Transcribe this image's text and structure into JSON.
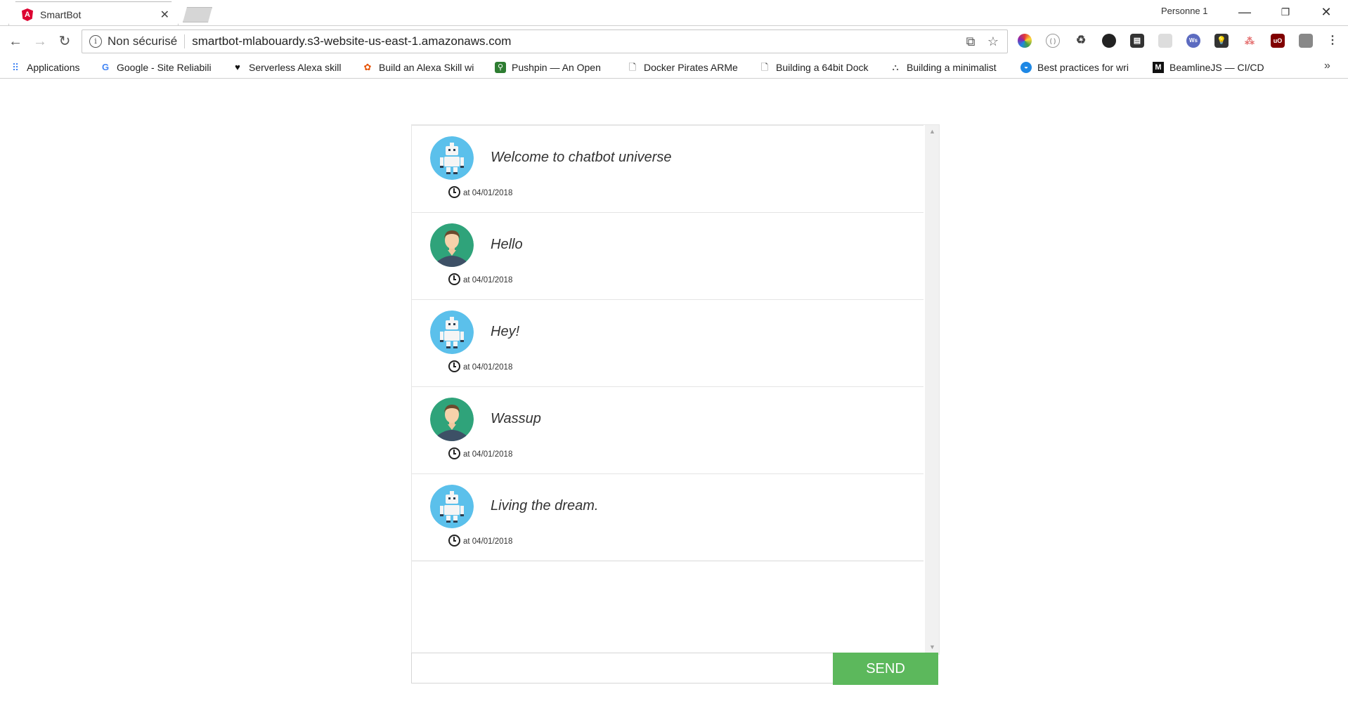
{
  "browser": {
    "tab_title": "SmartBot",
    "profile_name": "Personne 1",
    "security_label": "Non sécurisé",
    "url": "smartbot-mlabouardy.s3-website-us-east-1.amazonaws.com"
  },
  "bookmarks": [
    {
      "label": "Applications",
      "icon": "apps-grid-icon"
    },
    {
      "label": "Google - Site Reliabili",
      "icon": "google-icon"
    },
    {
      "label": "Serverless Alexa skill",
      "icon": "heart-icon"
    },
    {
      "label": "Build an Alexa Skill wi",
      "icon": "bookmark-logo-icon"
    },
    {
      "label": "Pushpin — An Open",
      "icon": "pushpin-icon"
    },
    {
      "label": "Docker Pirates ARMe",
      "icon": "page-icon"
    },
    {
      "label": "Building a 64bit Dock",
      "icon": "page-icon"
    },
    {
      "label": "Building a minimalist",
      "icon": "building-icon"
    },
    {
      "label": "Best practices for wri",
      "icon": "docker-icon"
    },
    {
      "label": "BeamlineJS — CI/CD",
      "icon": "medium-icon"
    }
  ],
  "chat": {
    "messages": [
      {
        "sender": "bot",
        "text": "Welcome to chatbot universe",
        "timestamp": "at 04/01/2018"
      },
      {
        "sender": "user",
        "text": "Hello",
        "timestamp": "at 04/01/2018"
      },
      {
        "sender": "bot",
        "text": "Hey!",
        "timestamp": "at 04/01/2018"
      },
      {
        "sender": "user",
        "text": "Wassup",
        "timestamp": "at 04/01/2018"
      },
      {
        "sender": "bot",
        "text": "Living the dream.",
        "timestamp": "at 04/01/2018"
      }
    ],
    "input_value": "",
    "send_label": "SEND"
  },
  "colors": {
    "send_button": "#5cb85c",
    "bot_avatar_bg": "#5bc0eb",
    "user_avatar_bg": "#2fa37a"
  }
}
